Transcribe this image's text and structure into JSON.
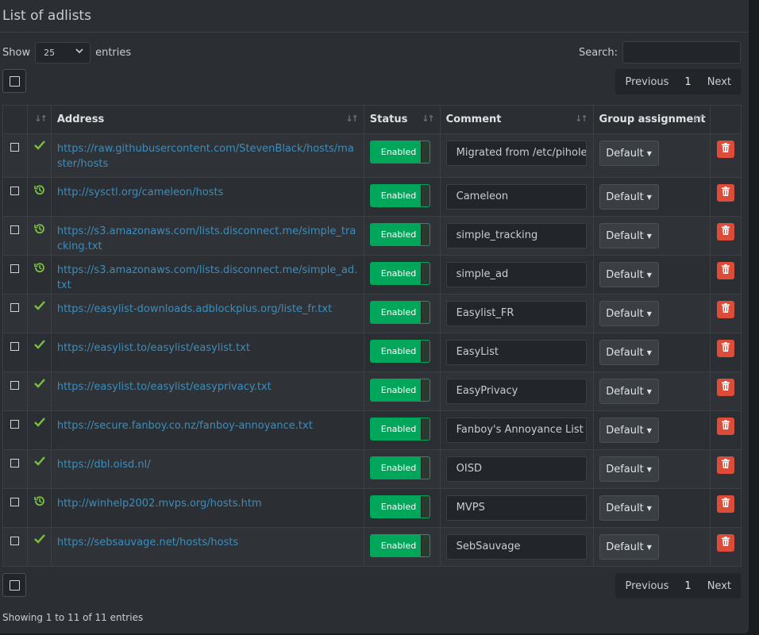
{
  "title": "List of adlists",
  "show": {
    "prefix": "Show",
    "value": "25",
    "suffix": "entries"
  },
  "search": {
    "label": "Search:",
    "placeholder": ""
  },
  "pagination": {
    "previous": "Previous",
    "page": "1",
    "next": "Next"
  },
  "columns": {
    "address": "Address",
    "status": "Status",
    "comment": "Comment",
    "group": "Group assignment"
  },
  "rows": [
    {
      "status_icon": "check-icon",
      "address": "https://raw.githubusercontent.com/StevenBlack/hosts/master/hosts",
      "status": "Enabled",
      "comment": "Migrated from /etc/pihole/adlists.list",
      "group": "Default"
    },
    {
      "status_icon": "history-icon",
      "address": "http://sysctl.org/cameleon/hosts",
      "status": "Enabled",
      "comment": "Cameleon",
      "group": "Default"
    },
    {
      "status_icon": "history-icon",
      "address": "https://s3.amazonaws.com/lists.disconnect.me/simple_tracking.txt",
      "status": "Enabled",
      "comment": "simple_tracking",
      "group": "Default"
    },
    {
      "status_icon": "history-icon",
      "address": "https://s3.amazonaws.com/lists.disconnect.me/simple_ad.txt",
      "status": "Enabled",
      "comment": "simple_ad",
      "group": "Default"
    },
    {
      "status_icon": "check-icon",
      "address": "https://easylist-downloads.adblockplus.org/liste_fr.txt",
      "status": "Enabled",
      "comment": "Easylist_FR",
      "group": "Default"
    },
    {
      "status_icon": "check-icon",
      "address": "https://easylist.to/easylist/easylist.txt",
      "status": "Enabled",
      "comment": "EasyList",
      "group": "Default"
    },
    {
      "status_icon": "check-icon",
      "address": "https://easylist.to/easylist/easyprivacy.txt",
      "status": "Enabled",
      "comment": "EasyPrivacy",
      "group": "Default"
    },
    {
      "status_icon": "check-icon",
      "address": "https://secure.fanboy.co.nz/fanboy-annoyance.txt",
      "status": "Enabled",
      "comment": "Fanboy's Annoyance List",
      "group": "Default"
    },
    {
      "status_icon": "check-icon",
      "address": "https://dbl.oisd.nl/",
      "status": "Enabled",
      "comment": "OISD",
      "group": "Default"
    },
    {
      "status_icon": "history-icon",
      "address": "http://winhelp2002.mvps.org/hosts.htm",
      "status": "Enabled",
      "comment": "MVPS",
      "group": "Default"
    },
    {
      "status_icon": "check-icon",
      "address": "https://sebsauvage.net/hosts/hosts",
      "status": "Enabled",
      "comment": "SebSauvage",
      "group": "Default"
    }
  ],
  "footer": "Showing 1 to 11 of 11 entries",
  "colors": {
    "enabled": "#00a65a",
    "delete": "#dd4b39",
    "link": "#3c8dbc",
    "ok": "#7ac142"
  }
}
